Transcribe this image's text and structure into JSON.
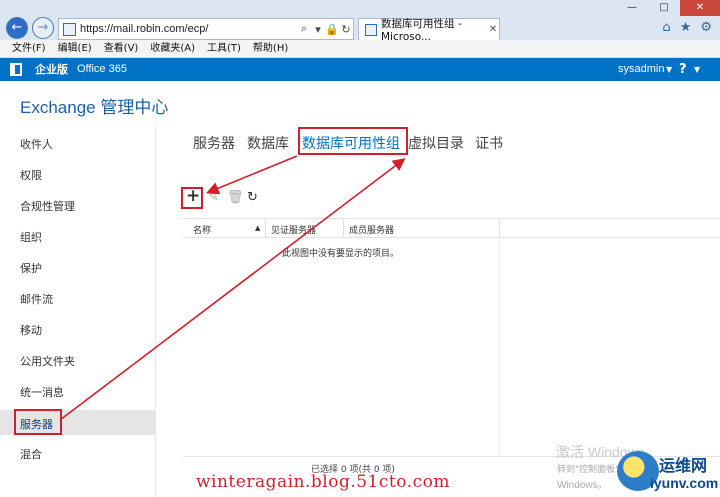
{
  "browser": {
    "url": "https://mail.robin.com/ecp/",
    "tab_title": "数据库可用性组 - Microso...",
    "window_buttons": [
      "—",
      "□",
      "✕"
    ],
    "menu": [
      "文件(F)",
      "编辑(E)",
      "查看(V)",
      "收藏夹(A)",
      "工具(T)",
      "帮助(H)"
    ]
  },
  "o365_bar": {
    "edition": "企业版",
    "product": "Office 365",
    "user": "sysadmin",
    "help": "?"
  },
  "app": {
    "title": "Exchange 管理中心"
  },
  "sidebar": {
    "items": [
      {
        "label": "收件人"
      },
      {
        "label": "权限"
      },
      {
        "label": "合规性管理"
      },
      {
        "label": "组织"
      },
      {
        "label": "保护"
      },
      {
        "label": "邮件流"
      },
      {
        "label": "移动"
      },
      {
        "label": "公用文件夹"
      },
      {
        "label": "统一消息"
      },
      {
        "label": "服务器",
        "selected": true
      },
      {
        "label": "混合"
      }
    ]
  },
  "tabs": [
    {
      "label": "服务器"
    },
    {
      "label": "数据库"
    },
    {
      "label": "数据库可用性组",
      "active": true
    },
    {
      "label": "虚拟目录"
    },
    {
      "label": "证书"
    }
  ],
  "toolbar": {
    "add": "+",
    "edit": "edit-icon",
    "delete": "delete-icon",
    "refresh": "refresh-icon"
  },
  "grid": {
    "columns": [
      "名称",
      "见证服务器",
      "成员服务器"
    ],
    "empty_message": "此视图中没有要显示的项目。",
    "status": "已选择 0 项(共 0 项)"
  },
  "watermarks": {
    "blog_url": "winteragain.blog.51cto.com",
    "activate_title": "激活 Windows",
    "activate_line2": "转到\"控制面板\"中的",
    "activate_line3": "Windows。",
    "brand": "运维网",
    "domain": "iyunv.com"
  },
  "colors": {
    "accent": "#0072c6",
    "annotation": "#d11f2b"
  }
}
